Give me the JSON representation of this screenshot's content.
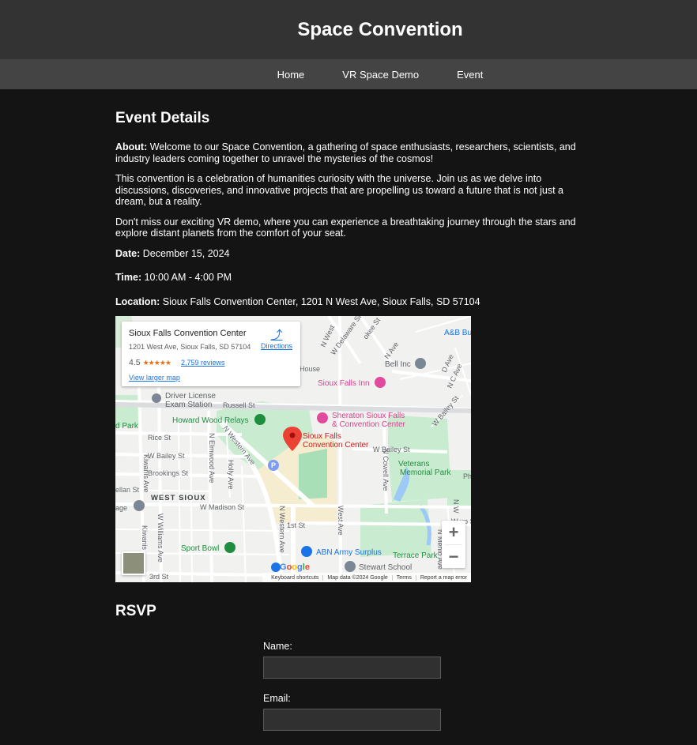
{
  "site": {
    "title": "Space Convention"
  },
  "nav": {
    "items": [
      {
        "label": "Home"
      },
      {
        "label": "VR Space Demo"
      },
      {
        "label": "Event"
      }
    ]
  },
  "event": {
    "heading": "Event Details",
    "about_label": "About:",
    "about_text": "Welcome to our Space Convention, a gathering of space enthusiasts, researchers, scientists, and industry leaders coming together to unravel the mysteries of the cosmos!",
    "para2": "This convention is a celebration of humanities curiosity with the universe. Join us as we delve into discussions, discoveries, and innovative projects that are propelling us toward a future that is not just a dream, but a reality.",
    "para3": "Don't miss our exciting VR demo, where you can experience a breathtaking journey through the stars and explore distant planets from the comfort of your seat.",
    "date_label": "Date:",
    "date_value": "December 15, 2024",
    "time_label": "Time:",
    "time_value": "10:00 AM - 4:00 PM",
    "location_label": "Location:",
    "location_value": "Sioux Falls Convention Center, 1201 N West Ave, Sioux Falls, SD 57104"
  },
  "map": {
    "place_name": "Sioux Falls Convention Center",
    "place_address": "1201 West Ave, Sioux Falls, SD 57104",
    "rating": "4.5",
    "stars_icon": "star-rating-icon",
    "reviews": "2,759 reviews",
    "directions": "Directions",
    "view_larger": "View larger map",
    "zoom_in": "+",
    "zoom_out": "−",
    "google_logo": "Google",
    "attribution": {
      "shortcuts": "Keyboard shortcuts",
      "data": "Map data ©2024 Google",
      "terms": "Terms",
      "report": "Report a map error"
    },
    "labels": {
      "marker": [
        "Sioux Falls",
        "Convention Center"
      ],
      "sheraton": [
        "Sheraton Sioux Falls",
        "& Convention Center"
      ],
      "sioux_falls_inn": "Sioux Falls Inn",
      "howard_wood": "Howard Wood Relays",
      "driver_license": [
        "Driver License",
        "Exam Station"
      ],
      "russell": "Russell St",
      "rice": "Rice St",
      "w_bailey_left": "W Bailey St",
      "brookings": "Brookings St",
      "west_sioux": "WEST SIOUX",
      "w_madison": "W Madison St",
      "first": "1st St",
      "third": "3rd St",
      "sport_bowl": "Sport Bowl",
      "abn": "ABN Army Surplus",
      "stewart": "Stewart School",
      "terrace": "Terrace Park",
      "veterans": [
        "Veterans",
        "Memorial Park"
      ],
      "w_bailey_right": "W Bailey St",
      "bell": "Bell Inc",
      "abb": "A&B Bu",
      "house": "House",
      "n_western": "N Western Ave",
      "s_western": "N Western Ave",
      "west_ave": "West Ave",
      "n_cowell": "N Cowell Ave",
      "kiwanis": "Kiwanis Ave",
      "kiwanis2": "Kiwanis",
      "w_williams": "W Williams Ave",
      "n_elmwood": "N Elmwood Ave",
      "holly": "Holly Ave",
      "n_delaware": "W Delaware St",
      "n_west": "N West",
      "okee": "okee St",
      "n_menlo": "N Menlo Ave",
      "park": "d Park",
      "age": "age",
      "ellan": "ellan St",
      "n_ave": "N Ave",
      "d_ave": "D Ave",
      "nc_ave": "N C Ave",
      "n_bailey": "W Bailey St",
      "ph": "Ph",
      "n_w": "N W",
      "w_up": "W up St",
      "p_label": "P"
    }
  },
  "rsvp": {
    "heading": "RSVP",
    "name_label": "Name:",
    "name_value": "",
    "email_label": "Email:",
    "email_value": ""
  }
}
